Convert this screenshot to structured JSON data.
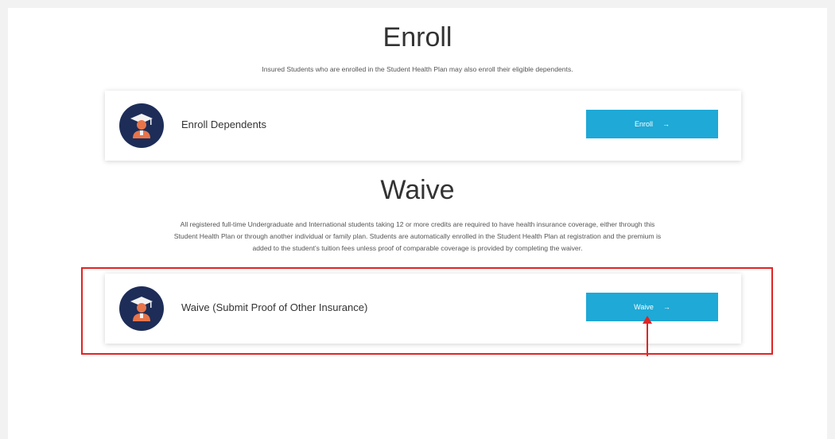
{
  "enroll": {
    "title": "Enroll",
    "description": "Insured Students who are enrolled in the Student Health Plan may also enroll their eligible dependents.",
    "card": {
      "label": "Enroll Dependents",
      "button_label": "Enroll",
      "button_icon": "→"
    }
  },
  "waive": {
    "title": "Waive",
    "description_lines": [
      "All registered full-time Undergraduate and International students taking 12 or more credits are required to have health insurance coverage, either through this",
      "Student Health Plan or through another individual or family plan. Students are automatically enrolled in the Student Health Plan at registration and the premium is",
      "added to the student’s tuition fees unless proof of comparable coverage is provided by completing the waiver."
    ],
    "card": {
      "label": "Waive (Submit Proof of Other Insurance)",
      "button_label": "Waive",
      "button_icon": "→"
    }
  },
  "colors": {
    "button": "#1ea9d6",
    "avatar_bg": "#1d2d58",
    "avatar_figure": "#e8744a",
    "annotation": "#e02424"
  },
  "icons": [
    "student-graduate-icon",
    "arrow-right-icon"
  ]
}
